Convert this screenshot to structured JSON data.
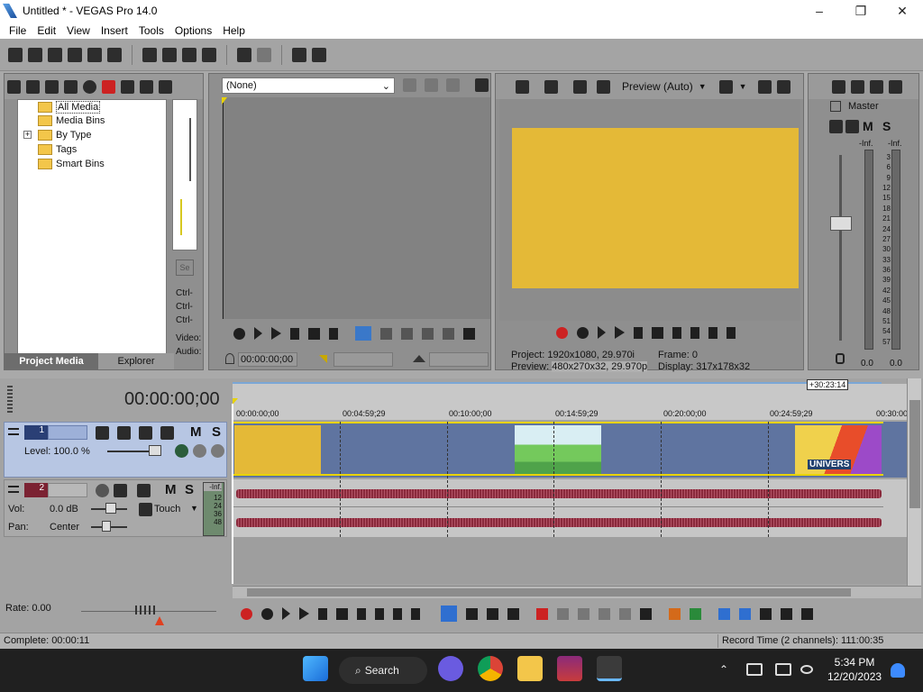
{
  "window": {
    "title": "Untitled * - VEGAS Pro 14.0",
    "min": "–",
    "max": "❐",
    "close": "✕"
  },
  "menu": [
    "File",
    "Edit",
    "View",
    "Insert",
    "Tools",
    "Options",
    "Help"
  ],
  "media_panel": {
    "tree": [
      "All Media",
      "Media Bins",
      "By Type",
      "Tags",
      "Smart Bins"
    ],
    "expand_glyph": "+",
    "tabs": [
      "Project Media",
      "Explorer"
    ],
    "side_labels": [
      "Ctrl-",
      "Ctrl-",
      "Ctrl-",
      "Video:",
      "Audio:"
    ],
    "side_badge": "Se"
  },
  "trimmer": {
    "dropdown": "(None)",
    "timecode": "00:00:00;00"
  },
  "preview": {
    "mode": "Preview (Auto)",
    "project_label": "Project:",
    "project_value": "1920x1080, 29.970i",
    "frame_label": "Frame:",
    "frame_value": "0",
    "preview_label": "Preview:",
    "preview_value": "480x270x32, 29.970p",
    "display_label": "Display:",
    "display_value": "317x178x32"
  },
  "master": {
    "label": "Master",
    "m": "M",
    "s": "S",
    "inf_l": "-Inf.",
    "inf_r": "-Inf.",
    "scale": [
      "3",
      "6",
      "9",
      "12",
      "15",
      "18",
      "21",
      "24",
      "27",
      "30",
      "33",
      "36",
      "39",
      "42",
      "45",
      "48",
      "51",
      "54",
      "57"
    ],
    "val_l": "0.0",
    "val_r": "0.0"
  },
  "timeline": {
    "timecode": "00:00:00;00",
    "ruler": [
      "00:00:00;00",
      "00:04:59;29",
      "00:10:00;00",
      "00:14:59;29",
      "00:20:00;00",
      "00:24:59;29",
      "00:30:00;"
    ],
    "end_marker": "+30:23:14",
    "video_track": {
      "number": "1",
      "m": "M",
      "s": "S",
      "level": "Level: 100.0 %",
      "clip_text": "UNIVERS"
    },
    "audio_track": {
      "number": "2",
      "m": "M",
      "s": "S",
      "vol_label": "Vol:",
      "vol_value": "0.0 dB",
      "pan_label": "Pan:",
      "pan_value": "Center",
      "mode": "Touch",
      "meter_top": "-Inf.",
      "meter_vals": [
        "12",
        "24",
        "36",
        "48"
      ]
    },
    "rate": "Rate: 0.00"
  },
  "status": {
    "left": "Complete: 00:00:11",
    "right": "Record Time (2 channels): 111:00:35"
  },
  "taskbar": {
    "search": "Search",
    "time": "5:34 PM",
    "date": "12/20/2023"
  },
  "colors": {
    "video_yellow": "#e4b937",
    "track_blue": "#5f74a0",
    "wave": "#8a2a3c",
    "accent": "#1b6fd6"
  }
}
